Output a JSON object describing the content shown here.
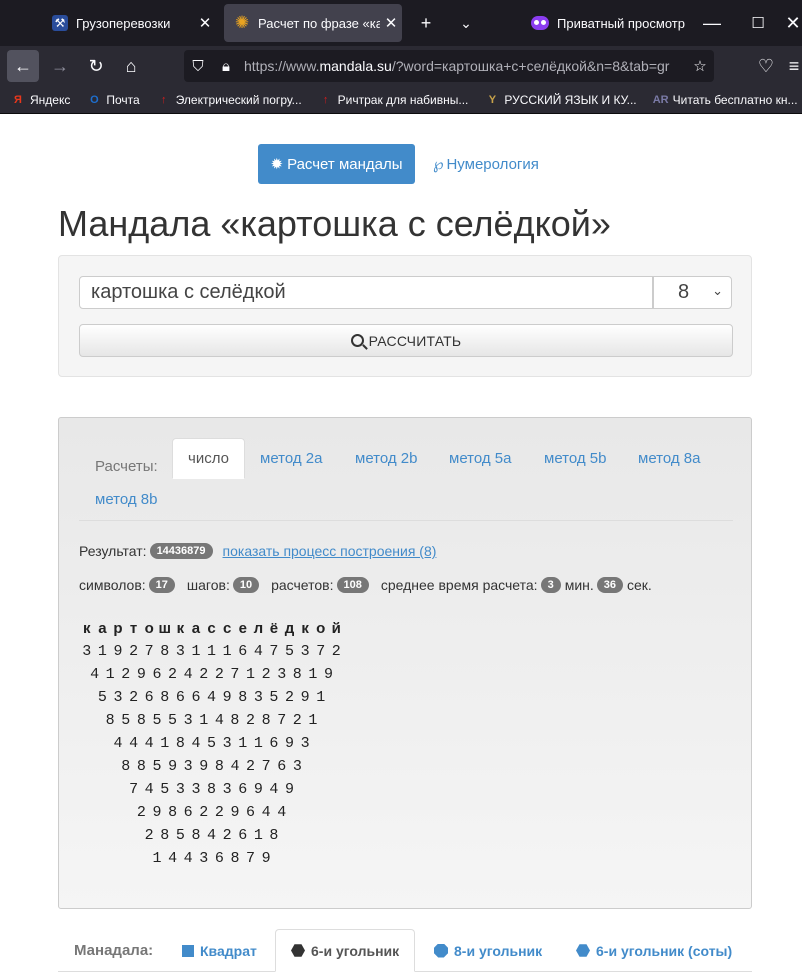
{
  "browser": {
    "tabs": [
      {
        "title": "Грузоперевозки",
        "icon": "truck-icon"
      },
      {
        "title": "Расчет по фразе «карт",
        "icon": "mandala-icon"
      }
    ],
    "private_label": "Приватный просмотр",
    "url_prefix": "https://www.",
    "url_domain": "mandala.su",
    "url_rest": "/?word=картошка+с+селёдкой&n=8&tab=gr",
    "bookmarks": [
      {
        "label": "Яндекс",
        "icon": "Я",
        "color": "#e8371c"
      },
      {
        "label": "Почта",
        "icon": "O",
        "color": "#1e6fcf"
      },
      {
        "label": "Электрический погру...",
        "icon": "↑",
        "color": "#d21d1d"
      },
      {
        "label": "Ричтрак для набивны...",
        "icon": "↑",
        "color": "#d21d1d"
      },
      {
        "label": "РУССКИЙ ЯЗЫК И КУ...",
        "icon": "Y",
        "color": "#c8a24a"
      },
      {
        "label": "Читать бесплатно кн...",
        "icon": "AR",
        "color": "#7a7aa6"
      }
    ]
  },
  "page": {
    "btn_mandala": "Расчет мандалы",
    "link_numerology": "Нумерология",
    "title": "Мандала «картошка с селёдкой»",
    "input_value": "картошка с селёдкой",
    "select_value": "8",
    "calc_button": "РАССЧИТАТЬ",
    "calc_label": "Расчеты:",
    "calc_tabs": [
      "число",
      "метод 2a",
      "метод 2b",
      "метод 5a",
      "метод 5b",
      "метод 8a",
      "метод 8b"
    ],
    "result_label": "Результат:",
    "result_value": "14436879",
    "result_link": "показать процесс построения (8)",
    "stats": {
      "symbols_label": "символов:",
      "symbols": "17",
      "steps_label": "шагов:",
      "steps": "10",
      "calcs_label": "расчетов:",
      "calcs": "108",
      "avg_label": "среднее время расчета:",
      "min": "3",
      "min_label": "мин.",
      "sec": "36",
      "sec_label": "сек."
    },
    "grid_letters": "картошкасселёдкой",
    "grid_rows": [
      "31927831116475372",
      "4129624227123819",
      "532686649835291",
      "85855314828721",
      "4441845311693",
      "885939842763",
      "74533836949",
      "2986229644",
      "285842618",
      "14436879"
    ],
    "mandala_label": "Манадала:",
    "mandala_tabs": [
      "Квадрат",
      "6-и угольник",
      "8-и угольник",
      "6-и угольник (соты)"
    ]
  }
}
